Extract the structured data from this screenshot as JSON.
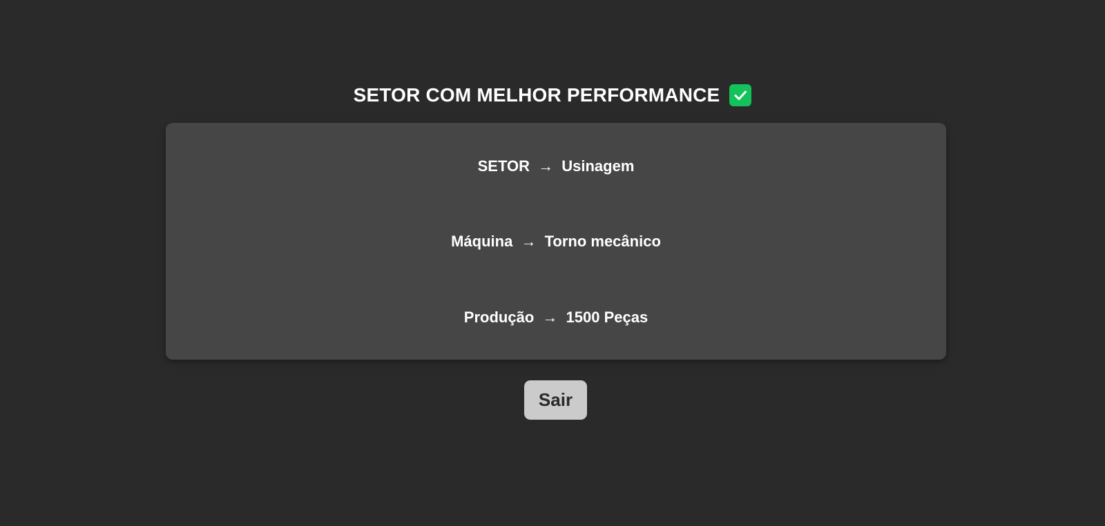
{
  "page": {
    "title": "SETOR COM MELHOR PERFORMANCE",
    "title_icon": "check-mark-icon"
  },
  "card": {
    "rows": [
      {
        "label": "SETOR",
        "separator": "→",
        "value": "Usinagem"
      },
      {
        "label": "Máquina",
        "separator": "→",
        "value": "Torno mecânico"
      },
      {
        "label": "Produção",
        "separator": "→",
        "value": "1500 Peças"
      }
    ]
  },
  "actions": {
    "exit_label": "Sair"
  },
  "colors": {
    "background": "#2a2a2a",
    "card": "#464646",
    "accent_check": "#13c25a",
    "button": "#cbcbcb"
  }
}
